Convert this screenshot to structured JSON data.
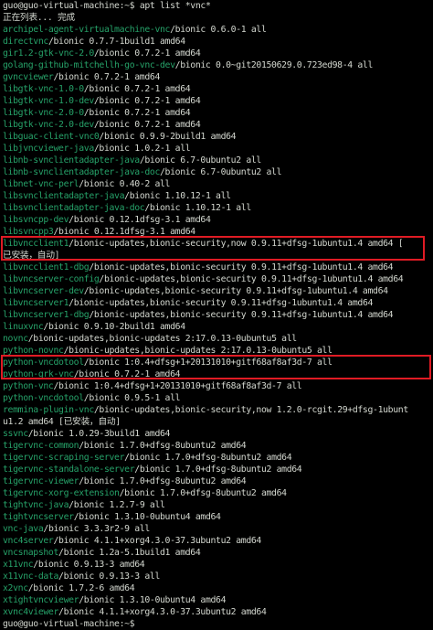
{
  "terminal": {
    "prompt": "guo@guo-virtual-machine:~$ ",
    "command": "apt list *vnc*",
    "status": "正在列表... 完成",
    "final_prompt": "guo@guo-virtual-machine:~$",
    "colors": {
      "background": "#000000",
      "text": "#d3d7cf",
      "package_name": "#26a269",
      "highlight_border": "#e01b24"
    },
    "packages": [
      {
        "name": "archipel-agent-virtualmachine-vnc",
        "info": "/bionic 0.6.0-1 all"
      },
      {
        "name": "directvnc",
        "info": "/bionic 0.7.7-1build1 amd64"
      },
      {
        "name": "gir1.2-gtk-vnc-2.0",
        "info": "/bionic 0.7.2-1 amd64"
      },
      {
        "name": "golang-github-mitchellh-go-vnc-dev",
        "info": "/bionic 0.0~git20150629.0.723ed98-4 all"
      },
      {
        "name": "gvncviewer",
        "info": "/bionic 0.7.2-1 amd64"
      },
      {
        "name": "libgtk-vnc-1.0-0",
        "info": "/bionic 0.7.2-1 amd64"
      },
      {
        "name": "libgtk-vnc-1.0-dev",
        "info": "/bionic 0.7.2-1 amd64"
      },
      {
        "name": "libgtk-vnc-2.0-0",
        "info": "/bionic 0.7.2-1 amd64"
      },
      {
        "name": "libgtk-vnc-2.0-dev",
        "info": "/bionic 0.7.2-1 amd64"
      },
      {
        "name": "libguac-client-vnc0",
        "info": "/bionic 0.9.9-2build1 amd64"
      },
      {
        "name": "libjvncviewer-java",
        "info": "/bionic 1.0.2-1 all"
      },
      {
        "name": "libnb-svnclientadapter-java",
        "info": "/bionic 6.7-0ubuntu2 all"
      },
      {
        "name": "libnb-svnclientadapter-java-doc",
        "info": "/bionic 6.7-0ubuntu2 all"
      },
      {
        "name": "libnet-vnc-perl",
        "info": "/bionic 0.40-2 all"
      },
      {
        "name": "libsvnclientadapter-java",
        "info": "/bionic 1.10.12-1 all"
      },
      {
        "name": "libsvnclientadapter-java-doc",
        "info": "/bionic 1.10.12-1 all"
      },
      {
        "name": "libsvncpp-dev",
        "info": "/bionic 0.12.1dfsg-3.1 amd64"
      },
      {
        "name": "libsvncpp3",
        "info": "/bionic 0.12.1dfsg-3.1 amd64"
      },
      {
        "name": "libvncclient1",
        "info": "/bionic-updates,bionic-security,now 0.9.11+dfsg-1ubuntu1.4 amd64 ["
      },
      {
        "name": "",
        "info": "已安装，自动]"
      },
      {
        "name": "libvncclient1-dbg",
        "info": "/bionic-updates,bionic-security 0.9.11+dfsg-1ubuntu1.4 amd64"
      },
      {
        "name": "libvncserver-config",
        "info": "/bionic-updates,bionic-security 0.9.11+dfsg-1ubuntu1.4 amd64"
      },
      {
        "name": "libvncserver-dev",
        "info": "/bionic-updates,bionic-security 0.9.11+dfsg-1ubuntu1.4 amd64"
      },
      {
        "name": "libvncserver1",
        "info": "/bionic-updates,bionic-security 0.9.11+dfsg-1ubuntu1.4 amd64"
      },
      {
        "name": "libvncserver1-dbg",
        "info": "/bionic-updates,bionic-security 0.9.11+dfsg-1ubuntu1.4 amd64"
      },
      {
        "name": "linuxvnc",
        "info": "/bionic 0.9.10-2build1 amd64"
      },
      {
        "name": "novnc",
        "info": "/bionic-updates,bionic-updates 2:17.0.13-0ubuntu5 all"
      },
      {
        "name": "python-novnc",
        "info": "/bionic-updates,bionic-updates 2:17.0.13-0ubuntu5 all"
      },
      {
        "name": "python-vncdotool",
        "info": "/bionic 1:0.4+dfsg+1+20131010+gitf68af8af3d-7 all"
      },
      {
        "name": "python-grk-vnc",
        "info": "/bionic 0.7.2-1 amd64"
      },
      {
        "name": "python-vnc",
        "info": "/bionic 1:0.4+dfsg+1+20131010+gitf68af8af3d-7 all"
      },
      {
        "name": "python-vncdotool",
        "info": "/bionic 0.9.5-1 all"
      },
      {
        "name": "remmina-plugin-vnc",
        "info": "/bionic-updates,bionic-security,now 1.2.0-rcgit.29+dfsg-1ubunt"
      },
      {
        "name": "",
        "info": "u1.2 amd64 [已安装，自动]"
      },
      {
        "name": "ssvnc",
        "info": "/bionic 1.0.29-3build1 amd64"
      },
      {
        "name": "tigervnc-common",
        "info": "/bionic 1.7.0+dfsg-8ubuntu2 amd64"
      },
      {
        "name": "tigervnc-scraping-server",
        "info": "/bionic 1.7.0+dfsg-8ubuntu2 amd64"
      },
      {
        "name": "tigervnc-standalone-server",
        "info": "/bionic 1.7.0+dfsg-8ubuntu2 amd64"
      },
      {
        "name": "tigervnc-viewer",
        "info": "/bionic 1.7.0+dfsg-8ubuntu2 amd64"
      },
      {
        "name": "tigervnc-xorg-extension",
        "info": "/bionic 1.7.0+dfsg-8ubuntu2 amd64"
      },
      {
        "name": "tightvnc-java",
        "info": "/bionic 1.2.7-9 all"
      },
      {
        "name": "tightvncserver",
        "info": "/bionic 1.3.10-0ubuntu4 amd64"
      },
      {
        "name": "vnc-java",
        "info": "/bionic 3.3.3r2-9 all"
      },
      {
        "name": "vnc4server",
        "info": "/bionic 4.1.1+xorg4.3.0-37.3ubuntu2 amd64"
      },
      {
        "name": "vncsnapshot",
        "info": "/bionic 1.2a-5.1build1 amd64"
      },
      {
        "name": "x11vnc",
        "info": "/bionic 0.9.13-3 amd64"
      },
      {
        "name": "x11vnc-data",
        "info": "/bionic 0.9.13-3 all"
      },
      {
        "name": "x2vnc",
        "info": "/bionic 1.7.2-6 amd64"
      },
      {
        "name": "xtightvncviewer",
        "info": "/bionic 1.3.10-0ubuntu4 amd64"
      },
      {
        "name": "xvnc4viewer",
        "info": "/bionic 4.1.1+xorg4.3.0-37.3ubuntu2 amd64"
      }
    ]
  }
}
